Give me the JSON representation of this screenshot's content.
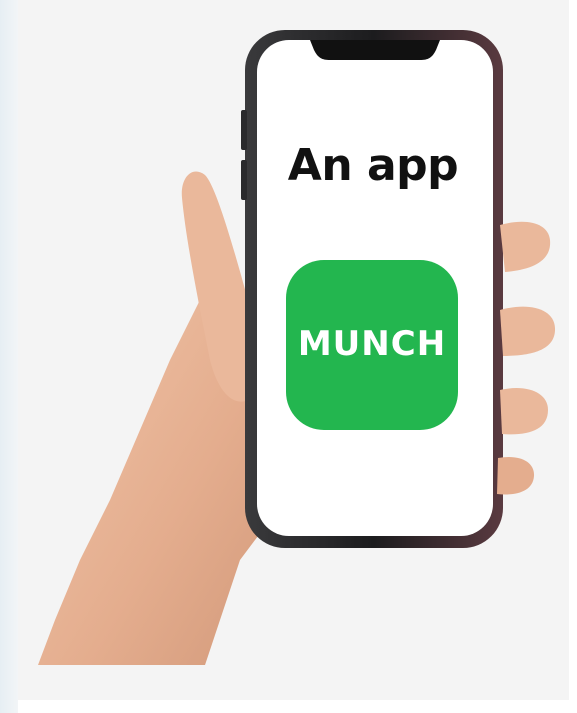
{
  "screen": {
    "headline": "An app"
  },
  "app_icon": {
    "label": "MUNCH",
    "background_color": "#23b64f",
    "text_color": "#ffffff"
  },
  "colors": {
    "page_background": "#f4f4f4",
    "phone_frame": "#1c1c1e",
    "screen_background": "#ffffff",
    "skin": "#e9b79a"
  }
}
